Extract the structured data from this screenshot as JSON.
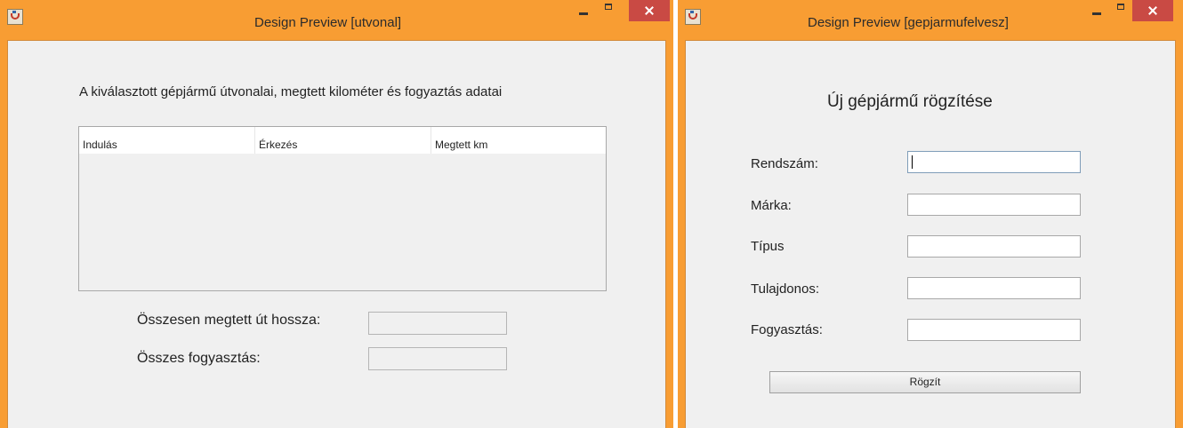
{
  "windows": [
    {
      "title": "Design Preview [utvonal]",
      "heading": "A kiválasztott gépjármű útvonalai, megtett kilométer és fogyaztás adatai",
      "table": {
        "columns": [
          "Indulás",
          "Érkezés",
          "Megtett km"
        ],
        "rows": []
      },
      "fields": {
        "total_distance_label": "Összesen megtett út hossza:",
        "total_distance_value": "",
        "total_consumption_label": "Összes fogyasztás:",
        "total_consumption_value": ""
      }
    },
    {
      "title": "Design Preview [gepjarmufelvesz]",
      "heading": "Új gépjármű rögzítése",
      "form": {
        "plate_label": "Rendszám:",
        "plate_value": "",
        "brand_label": "Márka:",
        "brand_value": "",
        "type_label": "Típus",
        "type_value": "",
        "owner_label": "Tulajdonos:",
        "owner_value": "",
        "consumption_label": "Fogyasztás:",
        "consumption_value": ""
      },
      "save_label": "Rögzít"
    }
  ],
  "icons": {
    "app": "java-coffee-cup-icon",
    "minimize": "minimize-icon",
    "maximize": "maximize-icon",
    "close": "close-icon"
  },
  "colors": {
    "titlebar": "#f89d33",
    "close_button": "#c94a44",
    "content_background": "#f0f0f0"
  }
}
